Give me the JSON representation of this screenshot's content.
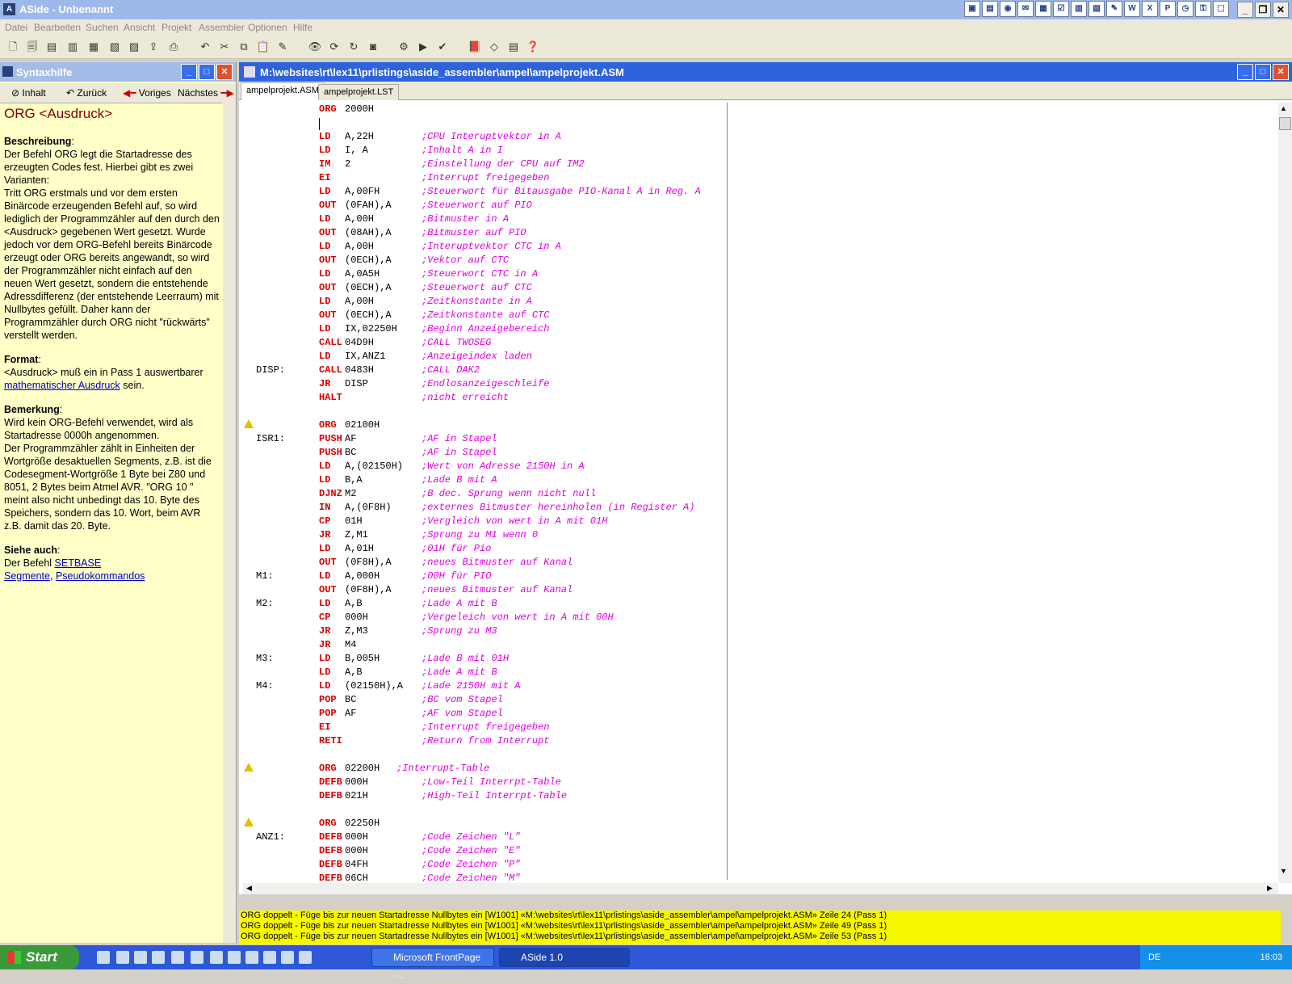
{
  "window": {
    "title": "ASide - Unbenannt"
  },
  "menu": [
    "Datei",
    "Bearbeiten",
    "Suchen",
    "Ansicht",
    "Projekt",
    "Assembler",
    "Optionen",
    "Hilfe"
  ],
  "help": {
    "title": "Syntaxhilfe",
    "nav": {
      "contents": "Inhalt",
      "back": "Zurück",
      "prev": "Voriges",
      "next": "Nächstes"
    },
    "heading": "ORG <Ausdruck>",
    "desc_h": "Beschreibung",
    "desc_1": "Der Befehl ORG legt die Startadresse des erzeugten Codes fest. Hierbei gibt es zwei Varianten:",
    "desc_2": "Tritt ORG erstmals und vor dem ersten Binärcode erzeugenden Befehl auf, so wird lediglich der Programmzähler auf den durch den <Ausdruck> gegebenen Wert gesetzt. Wurde jedoch vor dem ORG-Befehl bereits Binärcode erzeugt oder ORG bereits angewandt, so wird der Programmzähler nicht einfach auf den neuen Wert gesetzt, sondern die entstehende Adressdifferenz (der entstehende Leerraum) mit Nullbytes gefüllt. Daher kann der Programmzähler durch ORG nicht \"rückwärts\" verstellt werden.",
    "format_h": "Format",
    "format_1": "<Ausdruck> muß ein in Pass 1 auswertbarer",
    "format_link": "mathematischer Ausdruck",
    "format_2": " sein.",
    "remark_h": "Bemerkung",
    "remark_1": "Wird kein ORG-Befehl verwendet, wird als Startadresse 0000h angenommen.",
    "remark_2": "Der Programmzähler zählt in Einheiten der Wortgröße desaktuellen Segments, z.B. ist die Codesegment-Wortgröße 1 Byte bei Z80 und 8051, 2 Bytes beim Atmel AVR. \"ORG 10 \" meint also nicht unbedingt das 10. Byte des Speichers, sondern das 10. Wort, beim AVR z.B. damit das 20. Byte.",
    "see_h": "Siehe auch",
    "see_1": "Der Befehl ",
    "see_link1": "SETBASE",
    "see_link2": "Segmente",
    "see_sep": ", ",
    "see_link3": "Pseudokommandos"
  },
  "editor": {
    "title": "M:\\websites\\rt\\lex11\\prlistings\\aside_assembler\\ampel\\ampelprojekt.ASM",
    "tabs": [
      "ampelprojekt.ASM",
      "ampelprojekt.LST"
    ],
    "lines": [
      {
        "l": "",
        "k": "ORG",
        "o": "2000H",
        "c": ""
      },
      {
        "l": "",
        "k": "",
        "o": "",
        "c": "",
        "cursor": true
      },
      {
        "l": "",
        "k": "LD",
        "o": "A,22H",
        "c": ";CPU Interuptvektor in A"
      },
      {
        "l": "",
        "k": "LD",
        "o": "I, A",
        "c": ";Inhalt A in I"
      },
      {
        "l": "",
        "k": "IM",
        "o": "2",
        "c": ";Einstellung der CPU auf IM2"
      },
      {
        "l": "",
        "k": "EI",
        "o": "",
        "c": ";Interrupt freigegeben"
      },
      {
        "l": "",
        "k": "LD",
        "o": "A,00FH",
        "c": ";Steuerwort für Bitausgabe PIO-Kanal A in Reg. A"
      },
      {
        "l": "",
        "k": "OUT",
        "o": "(0FAH),A",
        "c": ";Steuerwort auf PIO"
      },
      {
        "l": "",
        "k": "LD",
        "o": "A,00H",
        "c": ";Bitmuster in A"
      },
      {
        "l": "",
        "k": "OUT",
        "o": "(08AH),A",
        "c": ";Bitmuster auf PIO"
      },
      {
        "l": "",
        "k": "LD",
        "o": "A,00H",
        "c": ";Interuptvektor CTC in A"
      },
      {
        "l": "",
        "k": "OUT",
        "o": "(0ECH),A",
        "c": ";Vektor auf CTC"
      },
      {
        "l": "",
        "k": "LD",
        "o": "A,0A5H",
        "c": ";Steuerwort CTC in A"
      },
      {
        "l": "",
        "k": "OUT",
        "o": "(0ECH),A",
        "c": ";Steuerwort auf CTC"
      },
      {
        "l": "",
        "k": "LD",
        "o": "A,00H",
        "c": ";Zeitkonstante in A"
      },
      {
        "l": "",
        "k": "OUT",
        "o": "(0ECH),A",
        "c": ";Zeitkonstante auf CTC"
      },
      {
        "l": "",
        "k": "LD",
        "o": "IX,02250H",
        "c": ";Beginn Anzeigebereich"
      },
      {
        "l": "",
        "k": "CALL",
        "o": "04D9H",
        "c": ";CALL TWOSEG"
      },
      {
        "l": "",
        "k": "LD",
        "o": "IX,ANZ1",
        "c": ";Anzeigeindex laden"
      },
      {
        "l": "DISP:",
        "k": "CALL",
        "o": "0483H",
        "c": ";CALL DAK2"
      },
      {
        "l": "",
        "k": "JR",
        "o": "DISP",
        "c": ";Endlosanzeigeschleife"
      },
      {
        "l": "",
        "k": "HALT",
        "o": "",
        "c": ";nicht erreicht"
      },
      {
        "l": "",
        "k": "",
        "o": "",
        "c": ""
      },
      {
        "l": "",
        "k": "ORG",
        "o": "02100H",
        "c": "",
        "warn": true
      },
      {
        "l": "ISR1:",
        "k": "PUSH",
        "o": "AF",
        "c": ";AF in Stapel"
      },
      {
        "l": "",
        "k": "PUSH",
        "o": "BC",
        "c": ";AF in Stapel"
      },
      {
        "l": "",
        "k": "LD",
        "o": "A,(02150H)",
        "c": ";Wert von Adresse 2150H in A"
      },
      {
        "l": "",
        "k": "LD",
        "o": "B,A",
        "c": ";Lade B mit A"
      },
      {
        "l": "",
        "k": "DJNZ",
        "o": "M2",
        "c": ";B dec. Sprung wenn nicht null"
      },
      {
        "l": "",
        "k": "IN",
        "o": "A,(0F8H)",
        "c": ";externes Bitmuster hereinholen (in Register A)"
      },
      {
        "l": "",
        "k": "CP",
        "o": "01H",
        "c": ";Vergleich von wert in A mit 01H"
      },
      {
        "l": "",
        "k": "JR",
        "o": "Z,M1",
        "c": ";Sprung zu M1 wenn 0"
      },
      {
        "l": "",
        "k": "LD",
        "o": "A,01H",
        "c": ";01H für Pio"
      },
      {
        "l": "",
        "k": "OUT",
        "o": "(0F8H),A",
        "c": ";neues Bitmuster auf Kanal"
      },
      {
        "l": "M1:",
        "k": "LD",
        "o": "A,000H",
        "c": ";00H für PIO"
      },
      {
        "l": "",
        "k": "OUT",
        "o": "(0F8H),A",
        "c": ";neues Bitmuster auf Kanal"
      },
      {
        "l": "M2:",
        "k": "LD",
        "o": "A,B",
        "c": ";Lade A mit B"
      },
      {
        "l": "",
        "k": "CP",
        "o": "000H",
        "c": ";Vergeleich von wert in A mit 00H"
      },
      {
        "l": "",
        "k": "JR",
        "o": "Z,M3",
        "c": ";Sprung zu M3"
      },
      {
        "l": "",
        "k": "JR",
        "o": "M4",
        "c": ""
      },
      {
        "l": "M3:",
        "k": "LD",
        "o": "B,005H",
        "c": ";Lade B mit 01H"
      },
      {
        "l": "",
        "k": "LD",
        "o": "A,B",
        "c": ";Lade A mit B"
      },
      {
        "l": "M4:",
        "k": "LD",
        "o": "(02150H),A",
        "c": ";Lade 2150H mit A"
      },
      {
        "l": "",
        "k": "POP",
        "o": "BC",
        "c": ";BC vom Stapel"
      },
      {
        "l": "",
        "k": "POP",
        "o": "AF",
        "c": ";AF vom Stapel"
      },
      {
        "l": "",
        "k": "EI",
        "o": "",
        "c": ";Interrupt freigegeben"
      },
      {
        "l": "",
        "k": "RETI",
        "o": "",
        "c": ";Return from Interrupt"
      },
      {
        "l": "",
        "k": "",
        "o": "",
        "c": ""
      },
      {
        "l": "",
        "k": "ORG",
        "o": "02200H",
        "c": ";Interrupt-Table",
        "warn": true,
        "cshort": true
      },
      {
        "l": "",
        "k": "DEFB",
        "o": "000H",
        "c": ";Low-Teil Interrpt-Table"
      },
      {
        "l": "",
        "k": "DEFB",
        "o": "021H",
        "c": ";High-Teil Interrpt-Table"
      },
      {
        "l": "",
        "k": "",
        "o": "",
        "c": ""
      },
      {
        "l": "",
        "k": "ORG",
        "o": "02250H",
        "c": "",
        "warn": true
      },
      {
        "l": "ANZ1:",
        "k": "DEFB",
        "o": "000H",
        "c": ";Code Zeichen \"L\""
      },
      {
        "l": "",
        "k": "DEFB",
        "o": "000H",
        "c": ";Code Zeichen \"E\""
      },
      {
        "l": "",
        "k": "DEFB",
        "o": "04FH",
        "c": ";Code Zeichen \"P\""
      },
      {
        "l": "",
        "k": "DEFB",
        "o": "06CH",
        "c": ";Code Zeichen \"M\""
      }
    ]
  },
  "messages": [
    "ORG doppelt - Füge bis zur neuen Startadresse Nullbytes ein [W1001] «M:\\websites\\rt\\lex11\\prlistings\\aside_assembler\\ampel\\ampelprojekt.ASM» Zeile 24 (Pass 1)",
    "ORG doppelt - Füge bis zur neuen Startadresse Nullbytes ein [W1001] «M:\\websites\\rt\\lex11\\prlistings\\aside_assembler\\ampel\\ampelprojekt.ASM» Zeile 49 (Pass 1)",
    "ORG doppelt - Füge bis zur neuen Startadresse Nullbytes ein [W1001] «M:\\websites\\rt\\lex11\\prlistings\\aside_assembler\\ampel\\ampelprojekt.ASM» Zeile 53 (Pass 1)"
  ],
  "taskbar": {
    "start": "Start",
    "tasks": [
      "Microsoft FrontPage -...",
      "ASide 1.0"
    ],
    "lang": "DE",
    "clock": "16:03"
  },
  "colors": {
    "keyword": "#d80000",
    "comment": "#e000e0",
    "warning": "#f8f800",
    "help_bg": "#ffffc8"
  }
}
